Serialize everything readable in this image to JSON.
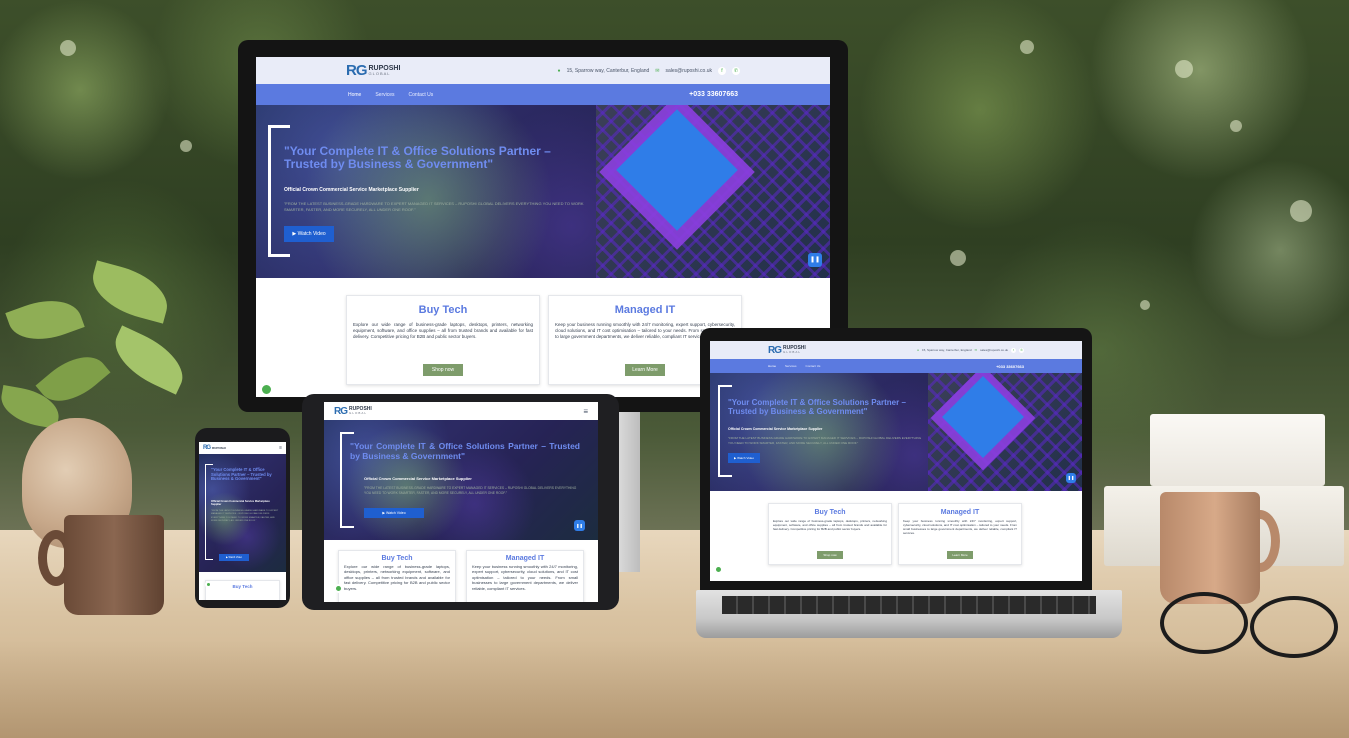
{
  "colors": {
    "nav_blue": "#5b7ae0",
    "hero_title": "#6f8cf0",
    "button_blue": "#1f5fd0",
    "card_button_green": "#7e9c6b",
    "accent_green": "#4caf50"
  },
  "site": {
    "logo": {
      "mark": "RG",
      "name": "RUPOSHI",
      "tagline": "GLOBAL"
    },
    "contact": {
      "address": "15, Sparrow way, Canterbur, England",
      "email": "sales@ruposhi.co.uk",
      "address_icon": "map-pin-icon",
      "email_icon": "mail-icon",
      "social_1": "f",
      "social_2": "✆"
    },
    "nav": {
      "items": [
        "Home",
        "Services",
        "Contact Us"
      ],
      "phone": "+033 33607663"
    },
    "hero": {
      "title": "\"Your Complete IT & Office Solutions Partner – Trusted by Business & Government\"",
      "subtitle": "Official Crown Commercial Service Marketplace Supplier",
      "body": "\"From the latest business-grade hardware to expert managed IT services – Ruposhi Global delivers everything you need to work smarter, faster, and more securely, all under one roof.\"",
      "button": "▶ Watch Video",
      "pause": "❚❚"
    },
    "cards": [
      {
        "title": "Buy Tech",
        "text": "Explore our wide range of business-grade laptops, desktops, printers, networking equipment, software, and office supplies – all from trusted brands and available for fast delivery. Competitive pricing for B2B and public sector buyers.",
        "button": "Shop now"
      },
      {
        "title": "Managed IT",
        "text": "Keep your business running smoothly with 24/7 monitoring, expert support, cybersecurity, cloud solutions, and IT cost optimisation – tailored to your needs. From small businesses to large government departments, we deliver reliable, compliant IT services.",
        "button": "Learn More"
      }
    ],
    "menu_icon": "≡",
    "chat_icon": "chat-icon"
  }
}
